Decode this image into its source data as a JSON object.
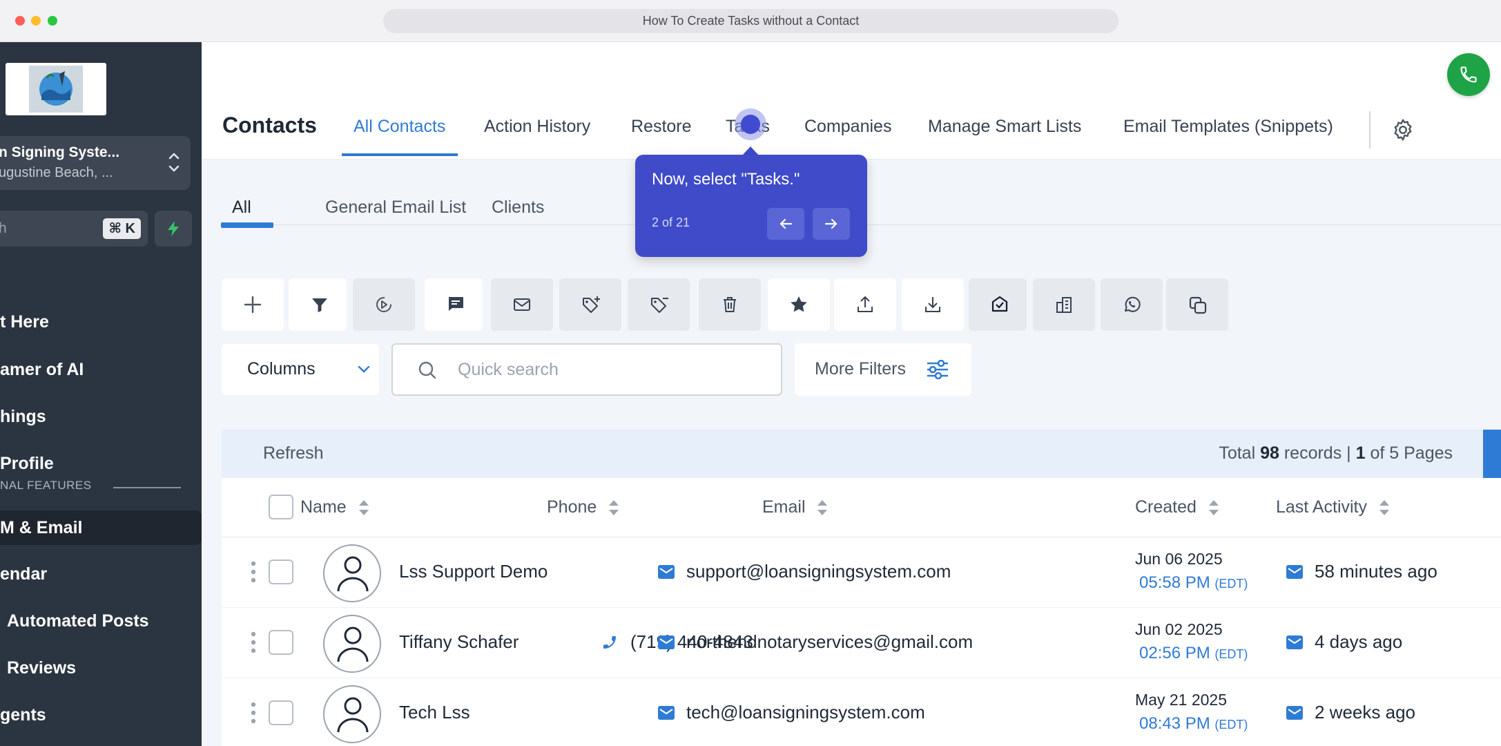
{
  "window": {
    "url_title": "How To Create Tasks without a Contact"
  },
  "sidebar": {
    "account_name": "n Signing Syste...",
    "account_location": "ugustine Beach, ...",
    "search_placeholder": "h",
    "search_shortcut": "⌘ K",
    "section_label": "NAL FEATURES",
    "items": [
      {
        "label": "t Here"
      },
      {
        "label": "amer of AI"
      },
      {
        "label": "hings"
      },
      {
        "label": "Profile"
      },
      {
        "label": "M & Email"
      },
      {
        "label": "endar"
      },
      {
        "label": "Automated Posts"
      },
      {
        "label": "Reviews"
      },
      {
        "label": "gents"
      }
    ]
  },
  "header": {
    "title": "Contacts",
    "tabs": [
      {
        "label": "All Contacts"
      },
      {
        "label": "Action History"
      },
      {
        "label": "Restore"
      },
      {
        "label": "Tasks"
      },
      {
        "label": "Companies"
      },
      {
        "label": "Manage Smart Lists"
      },
      {
        "label": "Email Templates (Snippets)"
      }
    ]
  },
  "subtabs": [
    {
      "label": "All"
    },
    {
      "label": "General Email List"
    },
    {
      "label": "Clients"
    }
  ],
  "toolbar": {
    "icons": [
      "plus-icon",
      "filter-icon",
      "workflow-icon",
      "sms-icon",
      "email-icon",
      "add-tag-icon",
      "remove-tag-icon",
      "delete-icon",
      "star-icon",
      "export-icon",
      "import-icon",
      "email-verify-icon",
      "company-icon",
      "whatsapp-icon",
      "merge-icon"
    ]
  },
  "controls": {
    "columns_label": "Columns",
    "search_placeholder": "Quick search",
    "more_filters_label": "More Filters"
  },
  "records_bar": {
    "refresh_label": "Refresh",
    "total_prefix": "Total",
    "total_count": "98",
    "records_word": "records |",
    "page_current": "1",
    "page_suffix": "of 5 Pages"
  },
  "table": {
    "headers": {
      "name": "Name",
      "phone": "Phone",
      "email": "Email",
      "created": "Created",
      "last_activity": "Last Activity"
    },
    "rows": [
      {
        "name": "Lss Support Demo",
        "phone": "",
        "email": "support@loansigningsystem.com",
        "created_date": "Jun 06 2025",
        "created_time": "05:58 PM",
        "tz": "(EDT)",
        "last_activity": "58 minutes ago"
      },
      {
        "name": "Tiffany Schafer",
        "phone": "(719) 440-4843",
        "email": "northendnotaryservices@gmail.com",
        "created_date": "Jun 02 2025",
        "created_time": "02:56 PM",
        "tz": "(EDT)",
        "last_activity": "4 days ago"
      },
      {
        "name": "Tech Lss",
        "phone": "",
        "email": "tech@loansigningsystem.com",
        "created_date": "May 21 2025",
        "created_time": "08:43 PM",
        "tz": "(EDT)",
        "last_activity": "2 weeks ago"
      }
    ]
  },
  "tour": {
    "message": "Now, select \"Tasks.\"",
    "step": "2 of 21"
  },
  "colors": {
    "accent": "#2e7bd6",
    "sidebar": "#2b3441",
    "tour": "#3f4bc9",
    "call": "#1ea446"
  }
}
